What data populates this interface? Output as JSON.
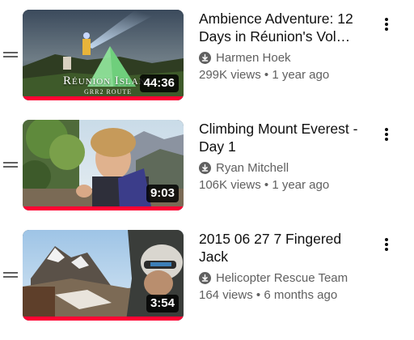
{
  "playlist": {
    "items": [
      {
        "title": "Ambience Adventure: 12 Days in Réunion's Vol…",
        "channel": "Harmen Hoek",
        "views": "299K views",
        "age": "1 year ago",
        "duration": "44:36",
        "thumbnail_text": "Réunion Island",
        "thumbnail_subtext": "GRR2 ROUTE",
        "watched_fraction": 1.0,
        "downloaded_icon": "download-icon",
        "menu_icon": "more-vert-icon"
      },
      {
        "title": "Climbing Mount Everest - Day 1",
        "channel": "Ryan Mitchell",
        "views": "106K views",
        "age": "1 year ago",
        "duration": "9:03",
        "watched_fraction": 1.0,
        "downloaded_icon": "download-icon",
        "menu_icon": "more-vert-icon"
      },
      {
        "title": "2015 06 27 7 Fingered Jack",
        "channel": "Helicopter Rescue Team",
        "views": "164 views",
        "age": "6 months ago",
        "duration": "3:54",
        "watched_fraction": 1.0,
        "downloaded_icon": "download-icon",
        "menu_icon": "more-vert-icon"
      }
    ],
    "separator": "•",
    "accent_color": "#ff0033",
    "drag_icon": "drag-handle-icon"
  }
}
